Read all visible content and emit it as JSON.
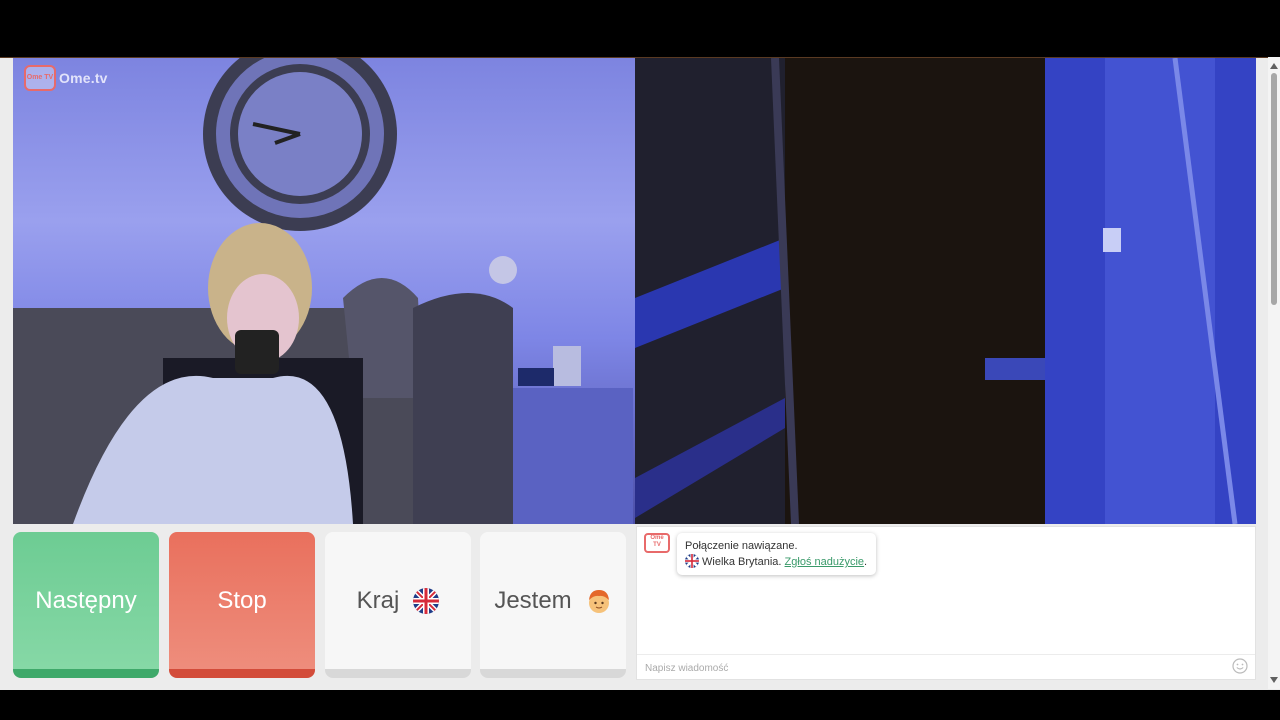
{
  "brand": {
    "logo_small": "Ome TV",
    "name": "Ome.tv"
  },
  "buttons": {
    "next": "Następny",
    "stop": "Stop",
    "country": "Kraj",
    "iam": "Jestem"
  },
  "chat": {
    "message_line1": "Połączenie nawiązane.",
    "country": "Wielka Brytania.",
    "report_link": "Zgłoś nadużycie",
    "report_suffix": ".",
    "input_placeholder": "Napisz wiadomość"
  },
  "icons": {
    "country_flag": "uk-flag-icon",
    "iam_avatar": "boy-emoji-icon",
    "emoji_button": "smiley-icon"
  },
  "colors": {
    "next": "#6dcc93",
    "stop": "#e9705d",
    "link": "#3a9a6a",
    "brand": "#e86a6a"
  }
}
